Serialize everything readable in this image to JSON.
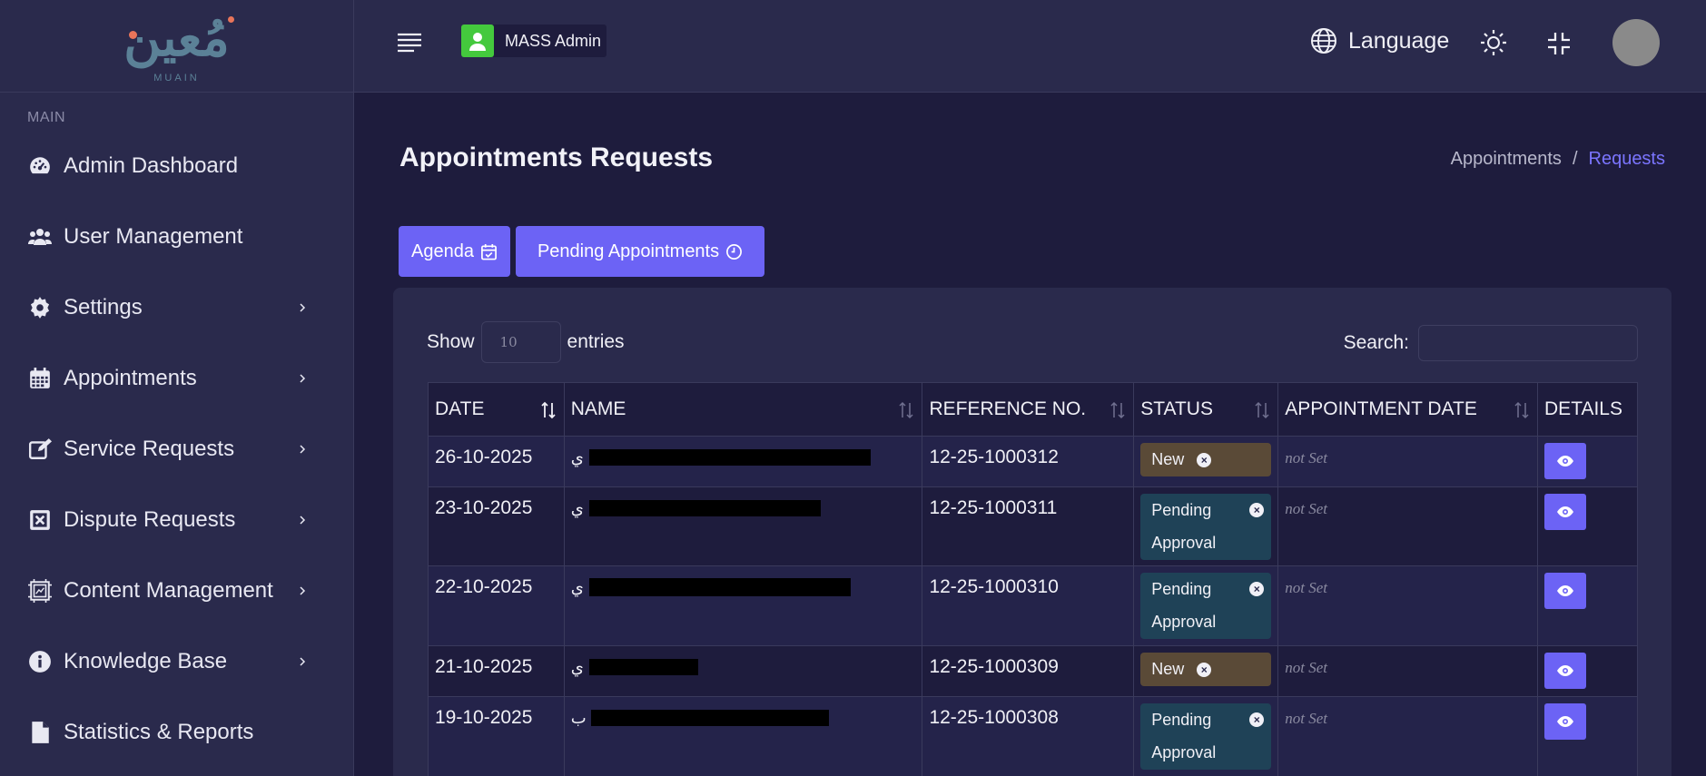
{
  "brand": {
    "logo_text": "مُعين",
    "logo_sub": "MUAIN",
    "accent": "#6c63f5"
  },
  "sidebar": {
    "section_label": "MAIN",
    "items": [
      {
        "label": "Admin Dashboard",
        "icon": "dashboard-icon",
        "has_chevron": false
      },
      {
        "label": "User Management",
        "icon": "users-icon",
        "has_chevron": false
      },
      {
        "label": "Settings",
        "icon": "gear-icon",
        "has_chevron": true
      },
      {
        "label": "Appointments",
        "icon": "calendar-icon",
        "has_chevron": true
      },
      {
        "label": "Service Requests",
        "icon": "edit-icon",
        "has_chevron": true
      },
      {
        "label": "Dispute Requests",
        "icon": "x-square-icon",
        "has_chevron": true
      },
      {
        "label": "Content Management",
        "icon": "content-icon",
        "has_chevron": true
      },
      {
        "label": "Knowledge Base",
        "icon": "info-icon",
        "has_chevron": true
      },
      {
        "label": "Statistics & Reports",
        "icon": "file-icon",
        "has_chevron": false
      }
    ]
  },
  "topbar": {
    "admin_name": "MASS Admin",
    "language_label": "Language"
  },
  "page": {
    "title": "Appointments Requests",
    "breadcrumb": [
      "Appointments",
      "/",
      "Requests"
    ],
    "buttons": {
      "agenda": "Agenda",
      "pending": "Pending Appointments"
    }
  },
  "table_controls": {
    "show_label": "Show",
    "entries_value": "10",
    "entries_label": "entries",
    "search_label": "Search:"
  },
  "table": {
    "columns": [
      "DATE",
      "NAME",
      "REFERENCE NO.",
      "STATUS",
      "APPOINTMENT DATE",
      "DETAILS"
    ],
    "rows": [
      {
        "date": "26-10-2025",
        "name_visible": "ي",
        "ref": "12-25-1000312",
        "status": "New",
        "status_type": "new",
        "appt_date": "not Set"
      },
      {
        "date": "23-10-2025",
        "name_visible": "ي",
        "ref": "12-25-1000311",
        "status_line1": "Pending",
        "status_line2": "Approval",
        "status_type": "pending",
        "appt_date": "not Set"
      },
      {
        "date": "22-10-2025",
        "name_visible": "ي",
        "ref": "12-25-1000310",
        "status_line1": "Pending",
        "status_line2": "Approval",
        "status_type": "pending",
        "appt_date": "not Set"
      },
      {
        "date": "21-10-2025",
        "name_visible": "ي",
        "ref": "12-25-1000309",
        "status": "New",
        "status_type": "new",
        "appt_date": "not Set"
      },
      {
        "date": "19-10-2025",
        "name_visible": "ب",
        "ref": "12-25-1000308",
        "status_line1": "Pending",
        "status_line2": "Approval",
        "status_type": "pending",
        "appt_date": "not Set"
      }
    ]
  }
}
